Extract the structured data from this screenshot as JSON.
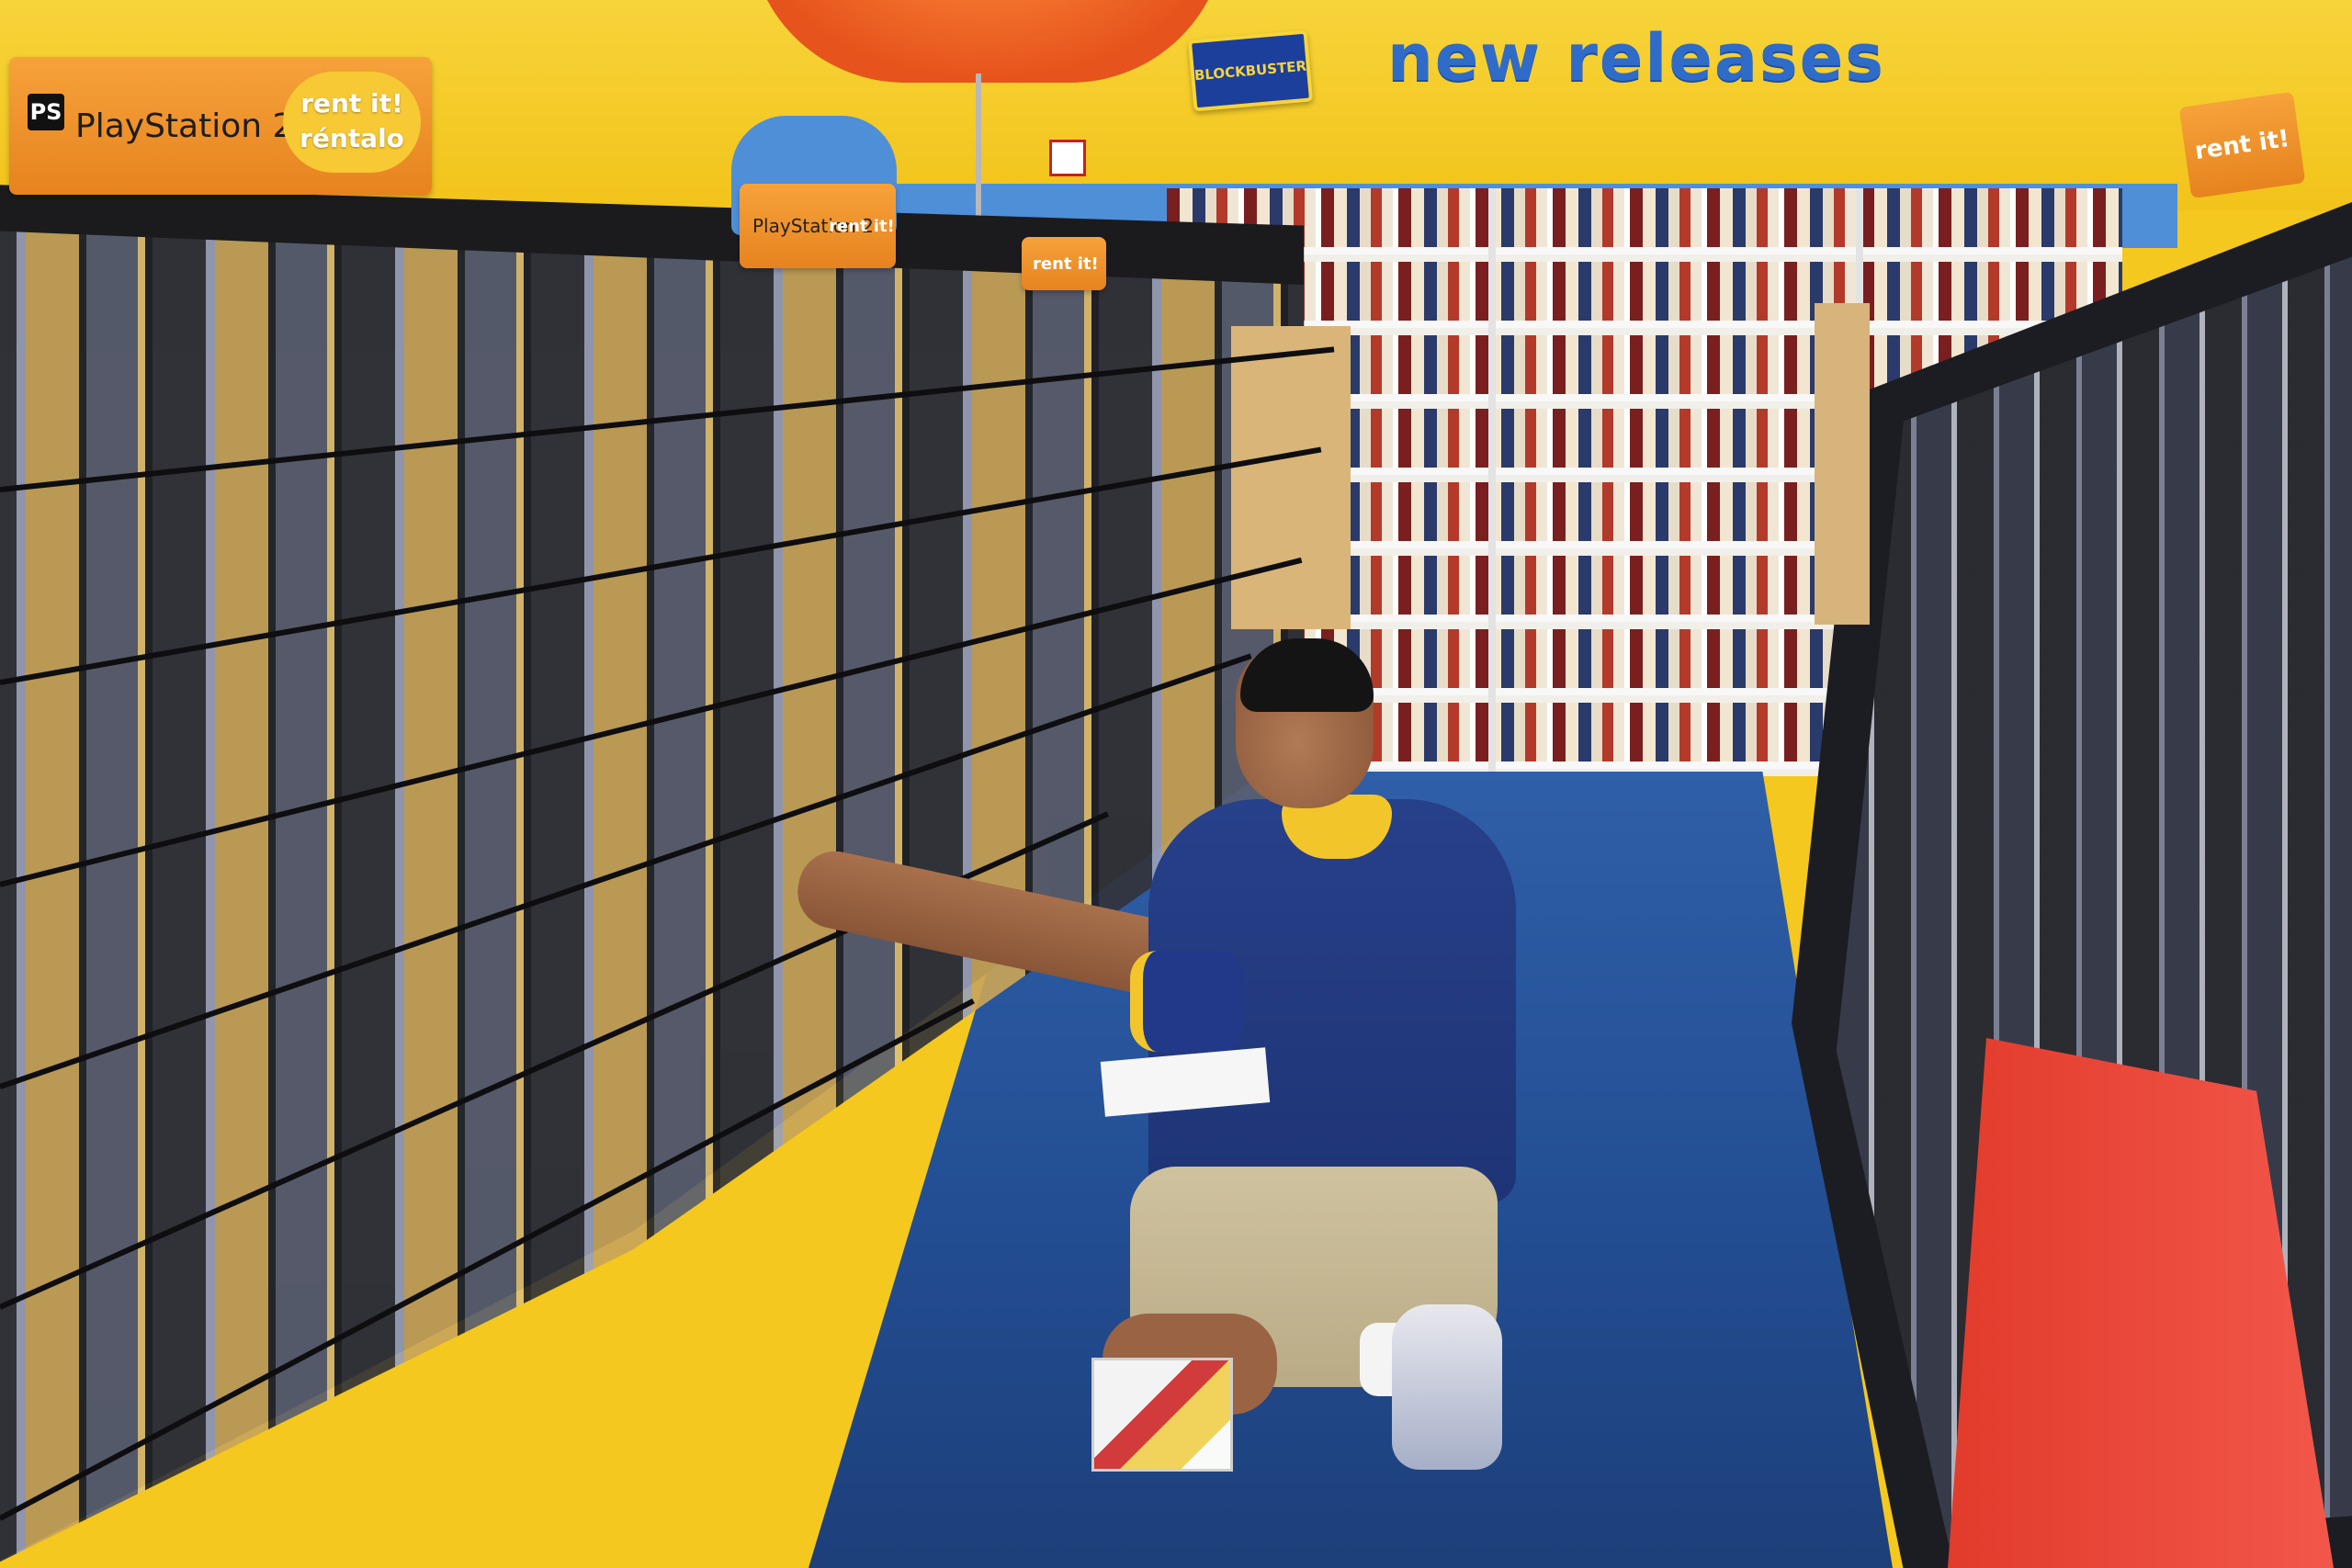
{
  "photo": {
    "section_sign": "new releases",
    "store_logo": "BLOCKBUSTER",
    "header_cards": [
      {
        "platform": "PlayStation 2",
        "logo_mark": "PS",
        "badge_line1": "rent it!",
        "badge_line2": "réntalo"
      },
      {
        "platform": "PlayStation 2",
        "badge": "rent it!"
      },
      {
        "badge": "rent it!"
      }
    ],
    "right_sign": "rent it!"
  },
  "colors": {
    "wall": "#f2c31a",
    "carpet": "#234e93",
    "sign_blue": "#2f6bc8",
    "header_orange": "#e7831f",
    "uniform_blue": "#1e3475",
    "uniform_yellow": "#f2c62a"
  }
}
